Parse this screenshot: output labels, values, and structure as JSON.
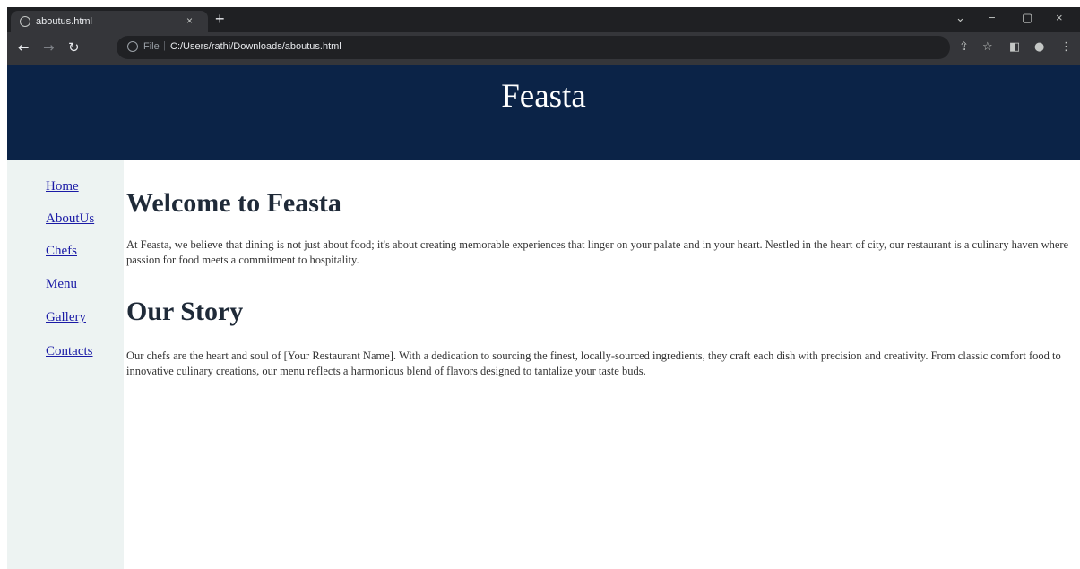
{
  "browser": {
    "tab_title": "aboutus.html",
    "tab_close": "×",
    "new_tab": "+",
    "window_controls": {
      "chevron": "⌄",
      "minimize": "−",
      "maximize": "▢",
      "close": "×"
    },
    "nav": {
      "back": "←",
      "forward": "→",
      "reload": "↻"
    },
    "address": {
      "scheme": "File",
      "url": "C:/Users/rathi/Downloads/aboutus.html"
    },
    "toolbar_icons": [
      "share-icon",
      "star-icon",
      "side-panel-icon",
      "profile-icon",
      "menu-icon"
    ]
  },
  "header": {
    "title": "Feasta"
  },
  "sidebar": {
    "items": [
      {
        "label": "Home"
      },
      {
        "label": "AboutUs"
      },
      {
        "label": "Chefs"
      },
      {
        "label": "Menu"
      },
      {
        "label": "Gallery"
      },
      {
        "label": "Contacts"
      }
    ]
  },
  "main": {
    "welcome_heading": "Welcome to Feasta",
    "welcome_text": "At Feasta, we believe that dining is not just about food; it's about creating memorable experiences that linger on your palate and in your heart. Nestled in the heart of city, our restaurant is a culinary haven where passion for food meets a commitment to hospitality.",
    "story_heading": "Our Story",
    "story_text": "Our chefs are the heart and soul of [Your Restaurant Name]. With a dedication to sourcing the finest, locally-sourced ingredients, they craft each dish with precision and creativity. From classic comfort food to innovative culinary creations, our menu reflects a harmonious blend of flavors designed to tantalize your taste buds."
  },
  "colors": {
    "header_bg": "#0b2347",
    "sidebar_bg": "#edf3f2",
    "link": "#1a1aa6"
  }
}
